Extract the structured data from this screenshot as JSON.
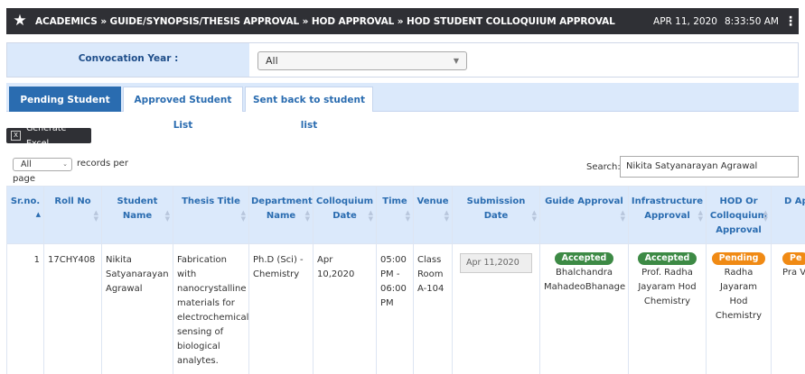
{
  "topbar": {
    "breadcrumb": "ACADEMICS » GUIDE/SYNOPSIS/THESIS APPROVAL » HOD APPROVAL » HOD STUDENT COLLOQUIUM APPROVAL",
    "date": "APR 11, 2020",
    "time": "8:33:50 AM",
    "star_icon": "star-icon",
    "menu_icon": "vertical-dots-icon"
  },
  "filter": {
    "label": "Convocation Year :",
    "selected": "All"
  },
  "tabs": [
    {
      "label": "Pending Student List"
    },
    {
      "label": "Approved Student List"
    },
    {
      "label": "Sent back to student list"
    }
  ],
  "toolbar": {
    "excel_label": "Generate Excel",
    "records_selected": "All",
    "records_text1": "records per",
    "records_text2": "page",
    "search_label": "Search:",
    "search_value": "Nikita Satyanarayan Agrawal"
  },
  "table": {
    "headers": [
      "Sr.no.",
      "Roll No",
      "Student Name",
      "Thesis Title",
      "Department Name",
      "Colloquium Date",
      "Time",
      "Venue",
      "Submission Date",
      "Guide Approval",
      "Infrastructure Approval",
      "HOD Or Colloquium Approval",
      "D App"
    ],
    "row": {
      "srno": "1",
      "roll": "17CHY408",
      "name": "Nikita Satyanarayan Agrawal",
      "title": "Fabrication with nanocrystalline materials for electrochemical sensing of biological analytes.",
      "department": "Ph.D (Sci) - Chemistry",
      "colloquium_date": "Apr 10,2020",
      "time": "05:00 PM - 06:00 PM",
      "venue": "Class Room A-104",
      "submission_date": "Apr 11,2020",
      "guide_status": "Accepted",
      "guide_name": "Bhalchandra MahadeoBhanage",
      "infra_status": "Accepted",
      "infra_name": "Prof. Radha Jayaram Hod Chemistry",
      "hod_status": "Pending",
      "hod_name": "Radha Jayaram Hod Chemistry",
      "d_status": "Pe",
      "d_name": "Pra Vavi"
    }
  },
  "colors": {
    "topbar": "#2f3035",
    "accent": "#2a6cb0",
    "header_bg": "#dbe9fb",
    "accepted": "#3d8a45",
    "pending": "#f08a14"
  }
}
